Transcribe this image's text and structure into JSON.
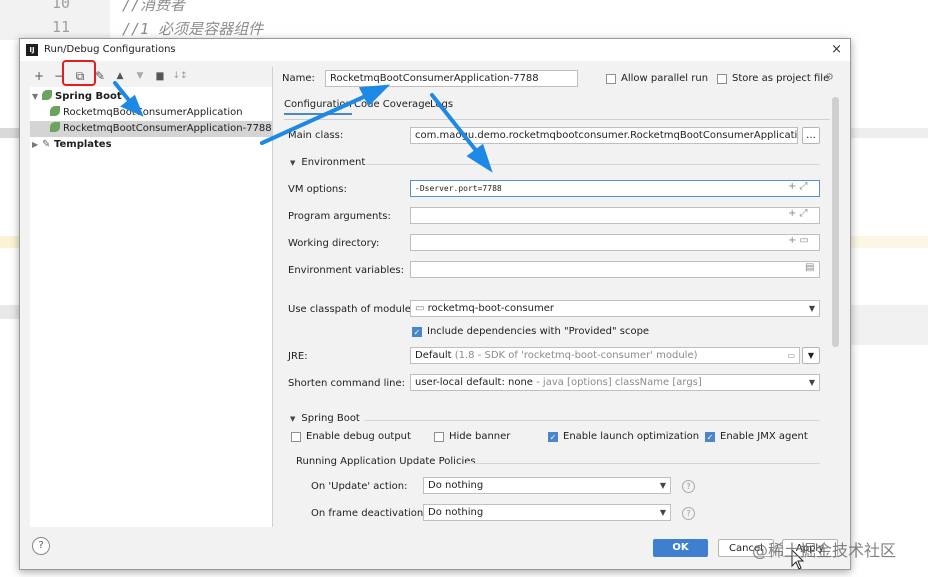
{
  "editor": {
    "lines": [
      {
        "num": "10",
        "code": "//消费者"
      },
      {
        "num": "11",
        "code": "//1 必须是容器组件"
      }
    ]
  },
  "dialog": {
    "title": "Run/Debug Configurations",
    "app_icon": "IJ",
    "close": "×"
  },
  "toolbar": {
    "add": "+",
    "remove": "−",
    "copy": "⧉",
    "edit": "✎",
    "move_up": "▲",
    "move_down": "▼",
    "folder": "▆",
    "sort": "↓↕"
  },
  "tree": {
    "group": "Spring Boot",
    "items": [
      "RocketmqBootConsumerApplication",
      "RocketmqBootConsumerApplication-7788"
    ],
    "templates": "Templates"
  },
  "form": {
    "name_label": "Name:",
    "name_value": "RocketmqBootConsumerApplication-7788",
    "allow_parallel": "Allow parallel run",
    "store_project": "Store as project file",
    "tabs": [
      "Configuration",
      "Code Coverage",
      "Logs"
    ],
    "main_class_label": "Main class:",
    "main_class_value": "com.maogu.demo.rocketmqbootconsumer.RocketmqBootConsumerApplication",
    "environment_section": "Environment",
    "vm_options_label": "VM options:",
    "vm_options_value": "-Dserver.port=7788",
    "program_args_label": "Program arguments:",
    "working_dir_label": "Working directory:",
    "env_vars_label": "Environment variables:",
    "classpath_label": "Use classpath of module:",
    "classpath_value": "rocketmq-boot-consumer",
    "include_deps": "Include dependencies with \"Provided\" scope",
    "jre_label": "JRE:",
    "jre_value": "Default",
    "jre_detail": "(1.8 - SDK of 'rocketmq-boot-consumer' module)",
    "shorten_label": "Shorten command line:",
    "shorten_value": "user-local default: none",
    "shorten_detail": " - java [options] className [args]",
    "spring_boot_section": "Spring Boot",
    "debug_output": "Enable debug output",
    "hide_banner": "Hide banner",
    "launch_opt": "Enable launch optimization",
    "jmx_agent": "Enable JMX agent",
    "policies_label": "Running Application Update Policies",
    "on_update_label": "On 'Update' action:",
    "on_update_value": "Do nothing",
    "on_frame_label": "On frame deactivation:",
    "on_frame_value": "Do nothing"
  },
  "buttons": {
    "ok": "OK",
    "cancel": "Cancel",
    "apply": "Apply",
    "help": "?"
  },
  "watermark": "@稀土掘金技术社区",
  "accent_colors": {
    "arrow": "#1e88e5",
    "highlight": "#e02020",
    "ok": "#3f7fcf"
  }
}
